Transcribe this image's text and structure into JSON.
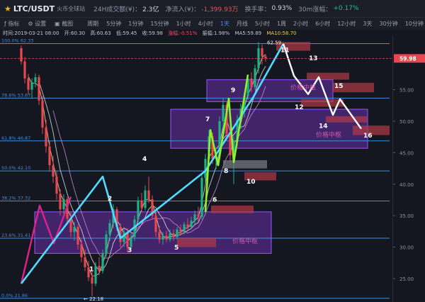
{
  "header": {
    "pair": "LTC/USDT",
    "source": "火币全球站",
    "vol_label": "24H成交额(¥)：",
    "vol_value": "2.3亿",
    "netflow_label": "净流入(¥)：",
    "netflow_value": "-1,399.93万",
    "turnover_label": "换手率：",
    "turnover_value": "0.93%",
    "change_label": "30m涨幅：",
    "change_value": "+0.17%"
  },
  "toolbar": {
    "indicator": "指标",
    "settings": "设置",
    "screenshot": "截图",
    "period_label": "周期",
    "intervals": [
      "5分钟",
      "1分钟",
      "15分钟",
      "1小时",
      "4小时",
      "1天",
      "月线",
      "5小时",
      "1周",
      "2小时",
      "6小时",
      "12小时",
      "3天",
      "30分钟",
      "10分钟"
    ],
    "active_interval": "1天"
  },
  "info_bar": {
    "time": "时间:2019-03-21 08:00",
    "open": "开:60.30",
    "high": "高:60.63",
    "low": "低:59.45",
    "close": "收:59.98",
    "change": "涨幅:-0.51%",
    "amplitude": "振幅:1.98%",
    "ma5": "MA5:59.89",
    "ma10": "MA10:58.70"
  },
  "colors": {
    "background": "#141720",
    "candle_up": "#1fb087",
    "candle_down": "#e9474f",
    "fib": "#3c8fe0",
    "wave_cyan": "#4fdcff",
    "wave_green": "#8df22e",
    "wave_pink": "#e0208c",
    "wave_white": "#ffffff",
    "price_tag": "#e9474f",
    "box_fill": "#7b35c8"
  },
  "chart_data": {
    "type": "candlestick",
    "ylim": [
      21.5,
      63.4
    ],
    "yticks": [
      25,
      30,
      35,
      40,
      45,
      50,
      55
    ],
    "current_price": 59.98,
    "fib_levels": [
      {
        "label": "100.0% 62.33",
        "value": 62.33
      },
      {
        "label": "78.6% 53.67",
        "value": 53.67
      },
      {
        "label": "61.8% 46.87",
        "value": 46.87
      },
      {
        "label": "50.0% 42.10",
        "value": 42.1
      },
      {
        "label": "38.2% 37.32",
        "value": 37.32
      },
      {
        "label": "23.6% 31.41",
        "value": 31.41
      },
      {
        "label": "0.0% 21.86",
        "value": 21.86
      }
    ],
    "annotations": {
      "high": "62.59",
      "low": "← 22.18",
      "box_label": "价格中枢",
      "wave_numbers": [
        "1",
        "2",
        "3",
        "4",
        "5",
        "6",
        "7",
        "8",
        "9",
        "10",
        "11",
        "12",
        "13",
        "14",
        "15",
        "16"
      ]
    },
    "waves": {
      "cyan": [
        [
          30,
          24.2
        ],
        [
          145,
          41.2
        ],
        [
          170,
          31.4
        ],
        [
          290,
          42.1
        ],
        [
          358,
          53.9
        ],
        [
          400,
          62.3
        ]
      ],
      "pink": [
        [
          30,
          24.2
        ],
        [
          56,
          36.6
        ],
        [
          76,
          30.6
        ],
        [
          100,
          38.0
        ]
      ],
      "green": [
        [
          150,
          35.6
        ],
        [
          157,
          48.6
        ],
        [
          168,
          43.0
        ],
        [
          183,
          53.6
        ],
        [
          190,
          43.5
        ],
        [
          210,
          57.4
        ]
      ],
      "white_projection": [
        [
          400,
          62.3
        ],
        [
          415,
          57.2
        ],
        [
          435,
          54.3
        ],
        [
          450,
          57.0
        ],
        [
          470,
          51.0
        ],
        [
          480,
          53.5
        ],
        [
          510,
          48.8
        ]
      ]
    },
    "candles": [
      {
        "o": 61.6,
        "h": 62.0,
        "l": 59.0,
        "c": 59.5
      },
      {
        "o": 59.5,
        "h": 60.2,
        "l": 56.0,
        "c": 56.8
      },
      {
        "o": 56.8,
        "h": 57.5,
        "l": 54.2,
        "c": 55.0
      },
      {
        "o": 55.0,
        "h": 56.8,
        "l": 53.6,
        "c": 56.2
      },
      {
        "o": 56.2,
        "h": 57.6,
        "l": 55.4,
        "c": 57.0
      },
      {
        "o": 57.0,
        "h": 57.4,
        "l": 52.6,
        "c": 53.3
      },
      {
        "o": 53.3,
        "h": 54.0,
        "l": 48.0,
        "c": 49.0
      },
      {
        "o": 49.0,
        "h": 50.2,
        "l": 45.0,
        "c": 46.0
      },
      {
        "o": 46.0,
        "h": 46.8,
        "l": 42.0,
        "c": 43.0
      },
      {
        "o": 43.0,
        "h": 44.5,
        "l": 40.2,
        "c": 41.2
      },
      {
        "o": 41.2,
        "h": 42.0,
        "l": 37.5,
        "c": 38.5
      },
      {
        "o": 38.5,
        "h": 39.2,
        "l": 35.0,
        "c": 36.0
      },
      {
        "o": 36.0,
        "h": 38.4,
        "l": 35.2,
        "c": 37.6
      },
      {
        "o": 37.6,
        "h": 38.0,
        "l": 33.8,
        "c": 34.5
      },
      {
        "o": 34.5,
        "h": 35.5,
        "l": 31.6,
        "c": 32.4
      },
      {
        "o": 32.4,
        "h": 34.0,
        "l": 31.0,
        "c": 33.2
      },
      {
        "o": 33.2,
        "h": 33.6,
        "l": 29.6,
        "c": 30.4
      },
      {
        "o": 30.4,
        "h": 31.2,
        "l": 27.6,
        "c": 28.4
      },
      {
        "o": 28.4,
        "h": 29.6,
        "l": 26.2,
        "c": 26.8
      },
      {
        "o": 26.8,
        "h": 27.8,
        "l": 24.6,
        "c": 25.2
      },
      {
        "o": 25.2,
        "h": 26.2,
        "l": 22.2,
        "c": 24.2
      },
      {
        "o": 24.2,
        "h": 27.6,
        "l": 23.8,
        "c": 27.0
      },
      {
        "o": 27.0,
        "h": 28.4,
        "l": 25.6,
        "c": 26.2
      },
      {
        "o": 26.2,
        "h": 29.6,
        "l": 25.8,
        "c": 29.0
      },
      {
        "o": 29.0,
        "h": 32.6,
        "l": 28.4,
        "c": 32.0
      },
      {
        "o": 32.0,
        "h": 34.4,
        "l": 31.0,
        "c": 33.8
      },
      {
        "o": 33.8,
        "h": 36.8,
        "l": 33.0,
        "c": 36.0
      },
      {
        "o": 36.0,
        "h": 36.4,
        "l": 32.6,
        "c": 33.2
      },
      {
        "o": 33.2,
        "h": 33.8,
        "l": 30.0,
        "c": 30.8
      },
      {
        "o": 30.8,
        "h": 33.0,
        "l": 30.0,
        "c": 32.4
      },
      {
        "o": 32.4,
        "h": 33.0,
        "l": 29.2,
        "c": 30.0
      },
      {
        "o": 30.0,
        "h": 32.2,
        "l": 29.6,
        "c": 31.6
      },
      {
        "o": 31.6,
        "h": 35.0,
        "l": 31.0,
        "c": 34.4
      },
      {
        "o": 34.4,
        "h": 38.0,
        "l": 34.0,
        "c": 37.4
      },
      {
        "o": 37.4,
        "h": 38.6,
        "l": 35.6,
        "c": 36.2
      },
      {
        "o": 36.2,
        "h": 39.8,
        "l": 35.8,
        "c": 39.0
      },
      {
        "o": 39.0,
        "h": 41.2,
        "l": 37.0,
        "c": 37.6
      },
      {
        "o": 37.6,
        "h": 38.2,
        "l": 34.4,
        "c": 35.0
      },
      {
        "o": 35.0,
        "h": 35.6,
        "l": 31.6,
        "c": 32.4
      },
      {
        "o": 32.4,
        "h": 33.4,
        "l": 30.6,
        "c": 31.2
      },
      {
        "o": 31.2,
        "h": 32.4,
        "l": 30.4,
        "c": 31.8
      },
      {
        "o": 31.8,
        "h": 32.6,
        "l": 30.8,
        "c": 31.2
      },
      {
        "o": 31.2,
        "h": 32.8,
        "l": 30.8,
        "c": 32.2
      },
      {
        "o": 32.2,
        "h": 32.8,
        "l": 31.0,
        "c": 31.6
      },
      {
        "o": 31.6,
        "h": 33.2,
        "l": 31.2,
        "c": 32.8
      },
      {
        "o": 32.8,
        "h": 33.6,
        "l": 31.8,
        "c": 32.4
      },
      {
        "o": 32.4,
        "h": 34.0,
        "l": 32.0,
        "c": 33.6
      },
      {
        "o": 33.6,
        "h": 34.6,
        "l": 32.8,
        "c": 33.2
      },
      {
        "o": 33.2,
        "h": 34.8,
        "l": 32.8,
        "c": 34.2
      },
      {
        "o": 34.2,
        "h": 35.8,
        "l": 33.6,
        "c": 35.2
      },
      {
        "o": 35.2,
        "h": 36.4,
        "l": 34.0,
        "c": 34.8
      },
      {
        "o": 34.8,
        "h": 41.8,
        "l": 34.4,
        "c": 41.0
      },
      {
        "o": 41.0,
        "h": 44.8,
        "l": 40.2,
        "c": 44.0
      },
      {
        "o": 44.0,
        "h": 48.6,
        "l": 43.2,
        "c": 47.6
      },
      {
        "o": 47.6,
        "h": 48.2,
        "l": 43.2,
        "c": 44.0
      },
      {
        "o": 44.0,
        "h": 45.8,
        "l": 42.4,
        "c": 45.0
      },
      {
        "o": 45.0,
        "h": 50.8,
        "l": 44.6,
        "c": 50.0
      },
      {
        "o": 50.0,
        "h": 53.6,
        "l": 48.6,
        "c": 52.6
      },
      {
        "o": 52.6,
        "h": 53.0,
        "l": 47.0,
        "c": 48.0
      },
      {
        "o": 48.0,
        "h": 48.6,
        "l": 43.5,
        "c": 44.6
      },
      {
        "o": 44.6,
        "h": 47.6,
        "l": 40.0,
        "c": 46.8
      },
      {
        "o": 46.8,
        "h": 51.0,
        "l": 46.0,
        "c": 50.2
      },
      {
        "o": 50.2,
        "h": 52.8,
        "l": 48.8,
        "c": 52.0
      },
      {
        "o": 52.0,
        "h": 54.6,
        "l": 50.6,
        "c": 54.0
      },
      {
        "o": 54.0,
        "h": 57.4,
        "l": 53.4,
        "c": 56.8
      },
      {
        "o": 56.8,
        "h": 57.8,
        "l": 54.6,
        "c": 55.4
      },
      {
        "o": 55.4,
        "h": 59.0,
        "l": 55.0,
        "c": 58.4
      },
      {
        "o": 58.4,
        "h": 62.59,
        "l": 57.6,
        "c": 61.6
      },
      {
        "o": 61.6,
        "h": 62.2,
        "l": 59.0,
        "c": 60.3
      },
      {
        "o": 60.3,
        "h": 60.63,
        "l": 59.45,
        "c": 59.98
      }
    ]
  }
}
